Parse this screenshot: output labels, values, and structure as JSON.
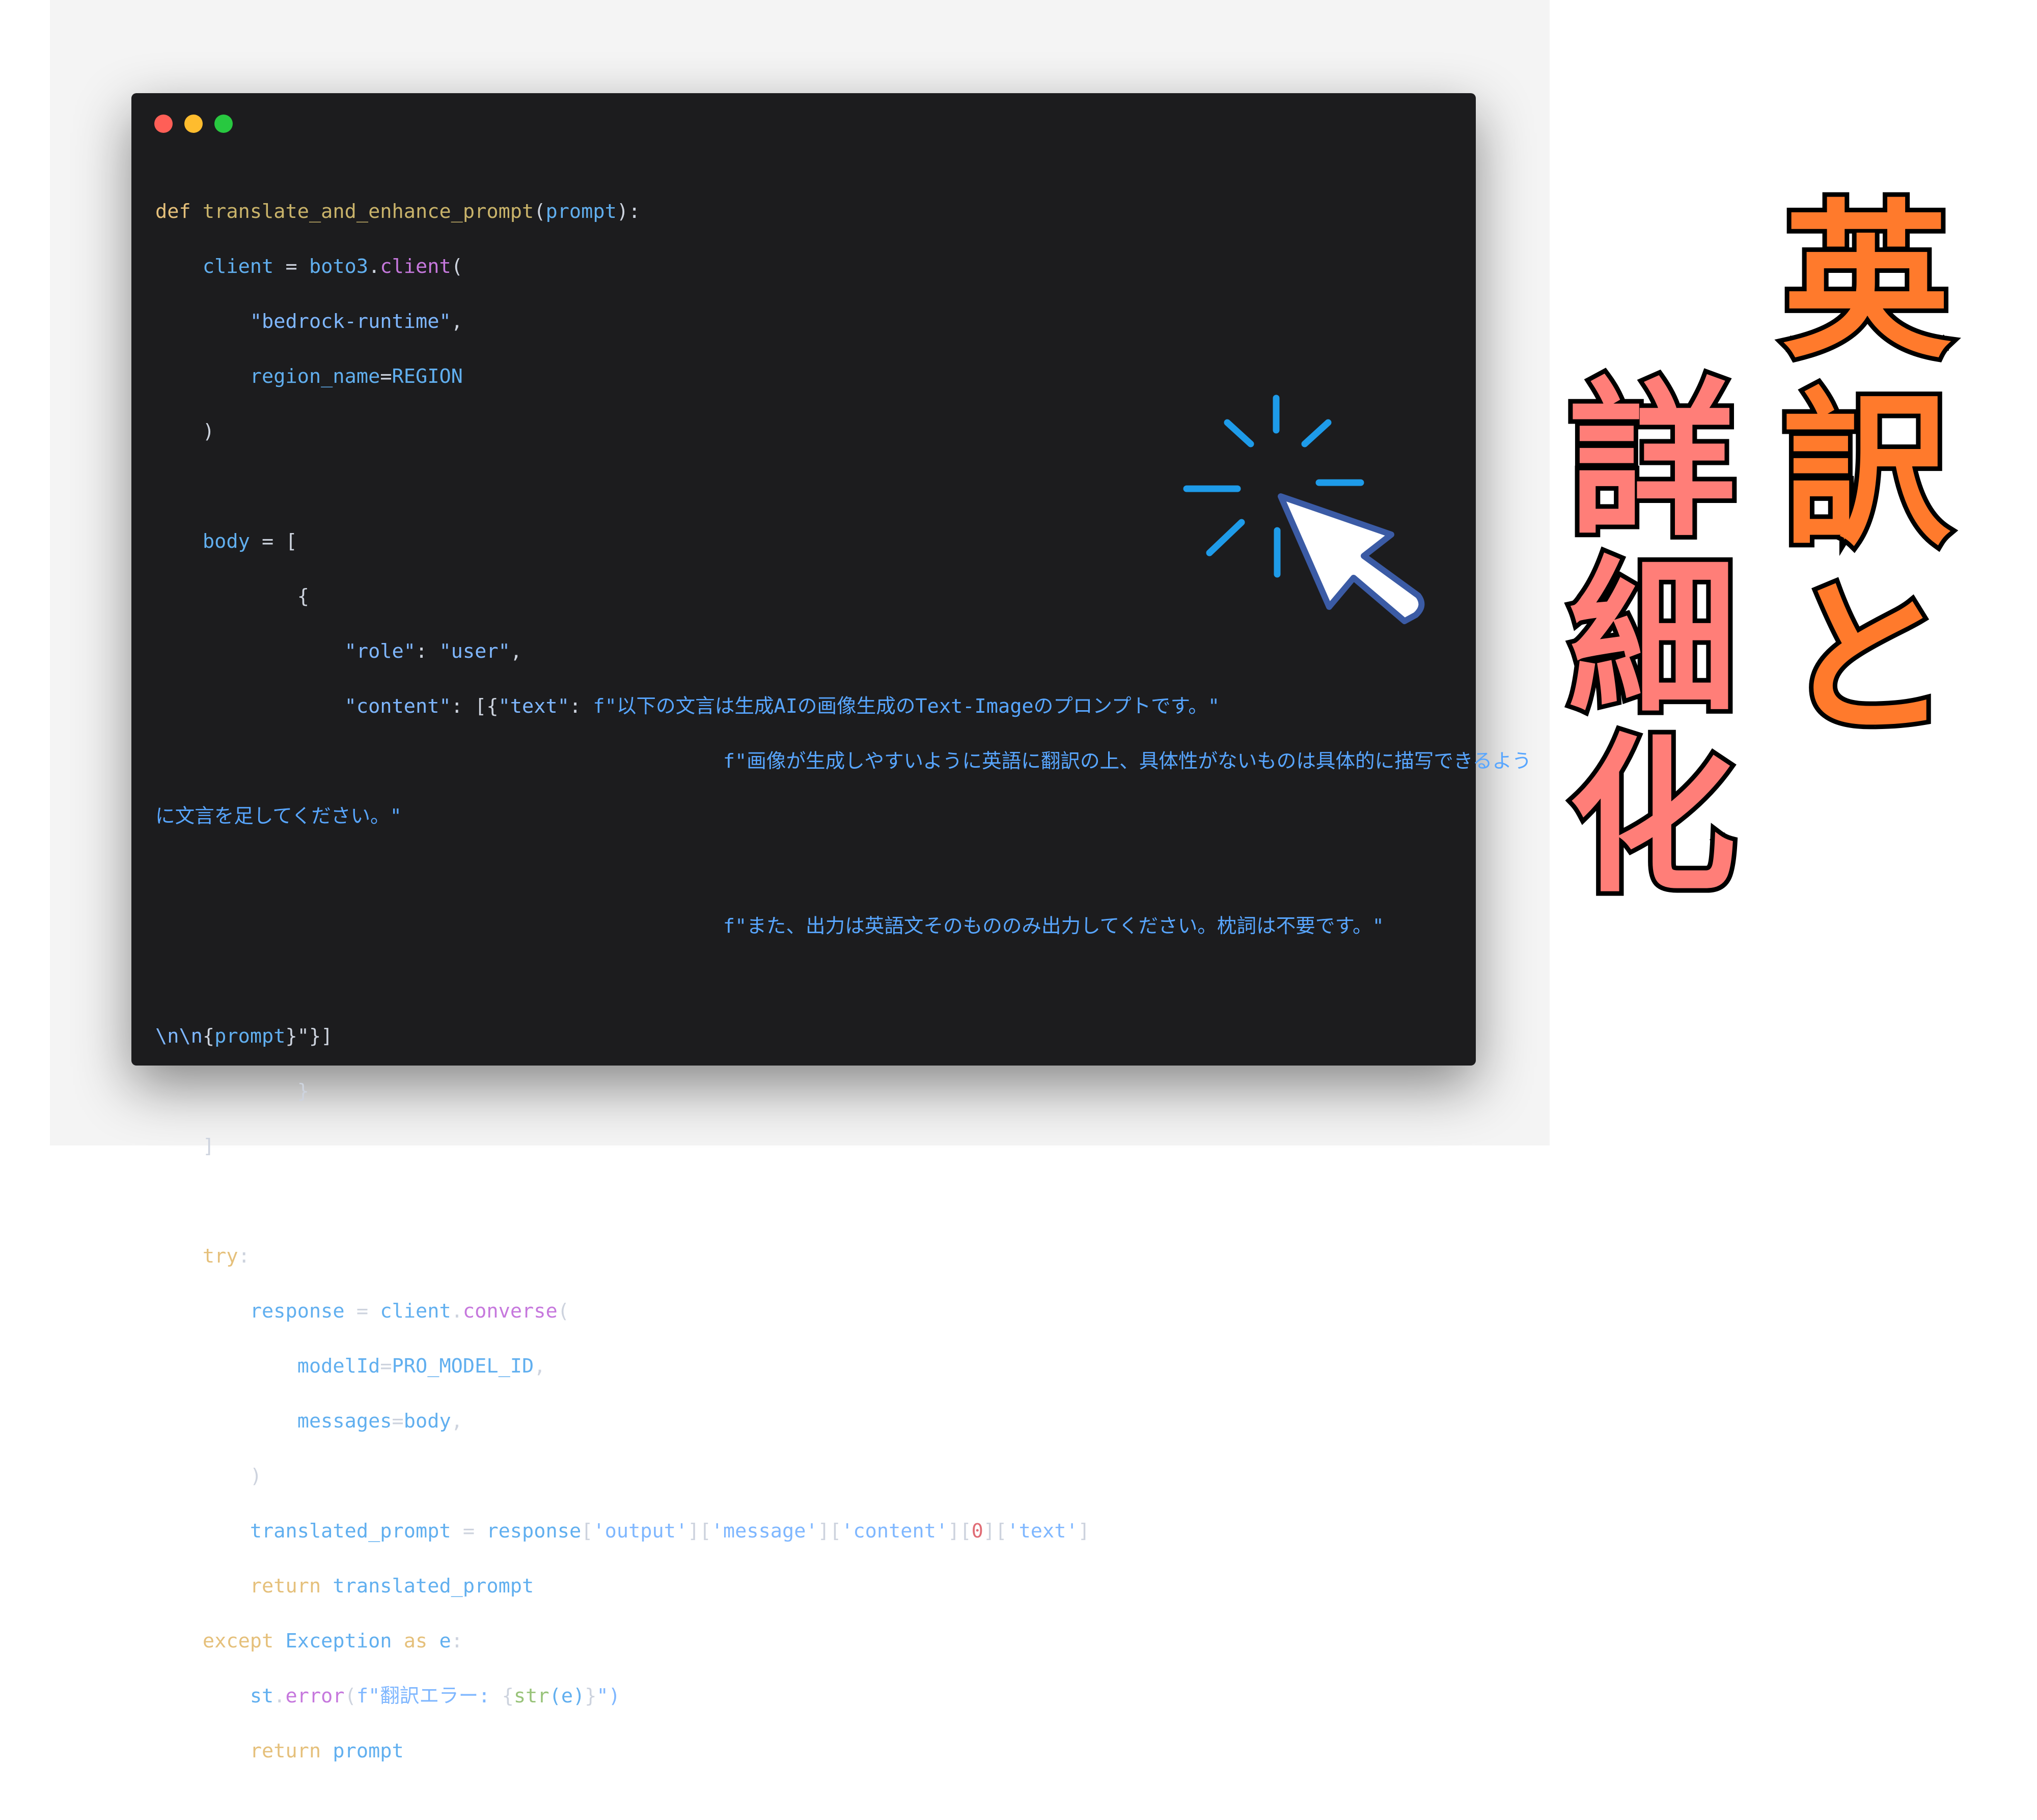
{
  "window": {
    "controls": [
      "close",
      "minimize",
      "maximize"
    ]
  },
  "code": {
    "l1": {
      "def": "def",
      "name": "translate_and_enhance_prompt",
      "open": "(",
      "param": "prompt",
      "close": "):"
    },
    "l2": {
      "var": "client",
      "eq": "=",
      "mod": "boto3",
      "dot": ".",
      "method": "client",
      "open": "("
    },
    "l3": {
      "str": "\"bedrock-runtime\"",
      "comma": ","
    },
    "l4": {
      "kw": "region_name",
      "eq": "=",
      "val": "REGION"
    },
    "l5": {
      "close": ")"
    },
    "l7": {
      "var": "body",
      "eq": "=",
      "open": "["
    },
    "l8": {
      "open": "{"
    },
    "l9": {
      "key": "\"role\"",
      "colon": ":",
      "val": "\"user\"",
      "comma": ","
    },
    "l10": {
      "key": "\"content\"",
      "mid": ": [{",
      "key2": "\"text\"",
      "colon": ":",
      "val": "f\"以下の文言は生成AIの画像生成のText-Imageのプロンプトです。\""
    },
    "l11": {
      "val": "f\"画像が生成しやすいように英語に翻訳の上、具体性がないものは具体的に描写できるよう"
    },
    "l12": {
      "val": "に文言を足してください。\""
    },
    "l14": {
      "val": "f\"また、出力は英語文そのもののみ出力してください。枕詞は不要です。\""
    },
    "l16": {
      "esc": "\\n\\n",
      "lb": "{",
      "var": "prompt",
      "rest": "}\"}]"
    },
    "l17": {
      "close": "}"
    },
    "l18": {
      "close": "]"
    },
    "l20": {
      "kw": "try",
      "colon": ":"
    },
    "l21": {
      "var": "response",
      "eq": "=",
      "obj": "client",
      "dot": ".",
      "method": "converse",
      "open": "("
    },
    "l22": {
      "kw": "modelId",
      "eq": "=",
      "val": "PRO_MODEL_ID",
      "comma": ","
    },
    "l23": {
      "kw": "messages",
      "eq": "=",
      "val": "body",
      "comma": ","
    },
    "l24": {
      "close": ")"
    },
    "l25": {
      "var": "translated_prompt",
      "eq": "=",
      "obj": "response",
      "b1o": "[",
      "k1": "'output'",
      "b1c": "][",
      "k2": "'message'",
      "b2c": "][",
      "k3": "'content'",
      "b3c": "][",
      "idx": "0",
      "b4c": "][",
      "k4": "'text'",
      "b5c": "]"
    },
    "l26": {
      "kw": "return",
      "val": "translated_prompt"
    },
    "l27": {
      "kw": "except",
      "cls": "Exception",
      "as": "as",
      "var": "e",
      "colon": ":"
    },
    "l28": {
      "obj": "st",
      "dot": ".",
      "method": "error",
      "open": "(",
      "str": "f\"翻訳エラー: ",
      "lb": "{",
      "fn": "str",
      "arg": "(e)",
      "rb": "}",
      "end": "\")"
    },
    "l29": {
      "kw": "return",
      "val": "prompt"
    }
  },
  "title_right": [
    "英",
    "訳",
    "と"
  ],
  "title_left": [
    "詳",
    "細",
    "化"
  ],
  "colors": {
    "background": "#ffffff",
    "editor_bg": "#1c1c1e",
    "title_orange": "#ff7a2c",
    "title_pink": "#ff7e78",
    "cursor_outline": "#3b5ba5",
    "sparkle": "#1e9be9"
  },
  "icons": [
    "mouse-pointer-click-icon",
    "sparkle-burst-icon"
  ]
}
